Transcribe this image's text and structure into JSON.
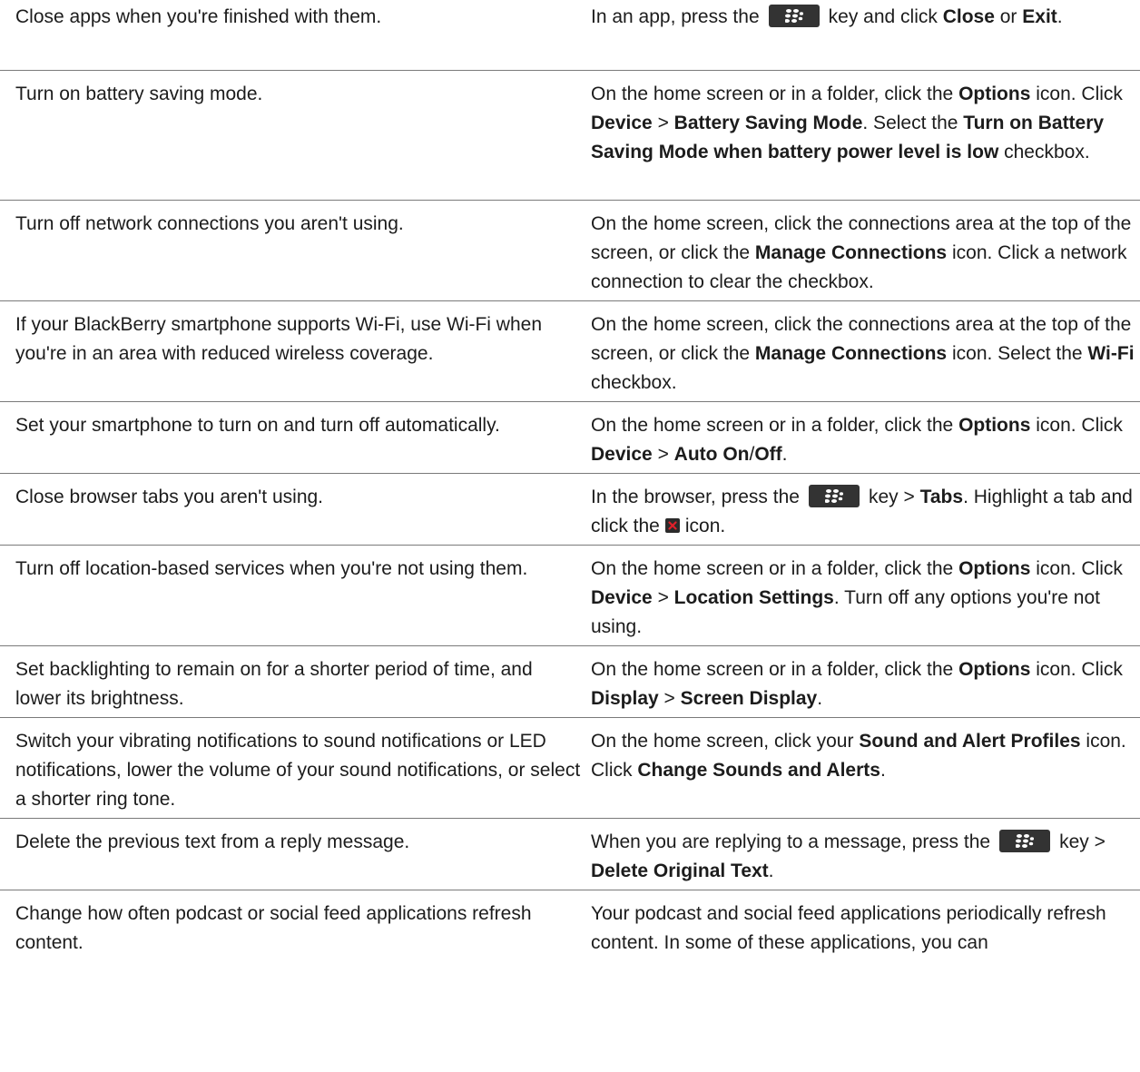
{
  "rows": [
    {
      "tip": "Close apps when you're finished with them.",
      "how": {
        "p1": "In an app, press the",
        "p2": "key and click",
        "b1": "Close",
        "p3": "or",
        "b2": "Exit",
        "p4": "."
      }
    },
    {
      "tip": "Turn on battery saving mode.",
      "how": {
        "p1": "On the home screen or in a folder, click the",
        "b1": "Options",
        "p2": "icon. Click",
        "b2": "Device",
        "p3": ">",
        "b3": "Battery Saving Mode",
        "p4": ". Select the",
        "b4": "Turn on Battery Saving Mode when battery power level is low",
        "p5": "checkbox."
      }
    },
    {
      "tip": "Turn off network connections you aren't using.",
      "how": {
        "p1": "On the home screen, click the connections area at the top of the screen, or click the",
        "b1": "Manage Connections",
        "p2": "icon. Click a network connection to clear the checkbox."
      }
    },
    {
      "tip": "If your BlackBerry smartphone supports Wi-Fi, use Wi-Fi when you're in an area with reduced wireless coverage.",
      "how": {
        "p1": "On the home screen, click the connections area at the top of the screen, or click the",
        "b1": "Manage Connections",
        "p2": "icon. Select the",
        "b2": "Wi-Fi",
        "p3": "checkbox."
      }
    },
    {
      "tip": "Set your smartphone to turn on and turn off automatically.",
      "how": {
        "p1": "On the home screen or in a folder, click the",
        "b1": "Options",
        "p2": "icon. Click",
        "b2": "Device",
        "p3": ">",
        "b3": "Auto On",
        "p4": "/",
        "b4": "Off",
        "p5": "."
      }
    },
    {
      "tip": "Close browser tabs you aren't using.",
      "how": {
        "p1": "In the browser, press the",
        "p2": "key >",
        "b1": "Tabs",
        "p3": ". Highlight a tab and click the",
        "p4": "icon."
      }
    },
    {
      "tip": "Turn off location-based services when you're not using them.",
      "how": {
        "p1": "On the home screen or in a folder, click the",
        "b1": "Options",
        "p2": "icon. Click",
        "b2": "Device",
        "p3": ">",
        "b3": "Location Settings",
        "p4": ". Turn off any options you're not using."
      }
    },
    {
      "tip": "Set backlighting to remain on for a shorter period of time, and lower its brightness.",
      "how": {
        "p1": "On the home screen or in a folder, click the",
        "b1": "Options",
        "p2": "icon. Click",
        "b2": "Display",
        "p3": ">",
        "b3": "Screen Display",
        "p4": "."
      }
    },
    {
      "tip": "Switch your vibrating notifications to sound notifications or LED notifications, lower the volume of your sound notifications, or select a shorter ring tone.",
      "how": {
        "p1": "On the home screen, click your",
        "b1": "Sound and Alert Profiles",
        "p2": "icon. Click",
        "b2": "Change Sounds and Alerts",
        "p3": "."
      }
    },
    {
      "tip": "Delete the previous text from a reply message.",
      "how": {
        "p1": "When you are replying to a message, press the",
        "p2": "key >",
        "b1": "Delete Original Text",
        "p3": "."
      }
    },
    {
      "tip": "Change how often podcast or social feed applications refresh content.",
      "how": {
        "p1": "Your podcast and social feed applications periodically refresh content. In some of these applications, you can"
      }
    }
  ],
  "icons": {
    "menu_key": "blackberry-menu-key-icon",
    "close_tab": "close-tab-icon"
  },
  "colors": {
    "text": "#1c1c1c",
    "divider": "#7a7a7a",
    "key_background": "#333333",
    "close_x": "#e0202a"
  }
}
